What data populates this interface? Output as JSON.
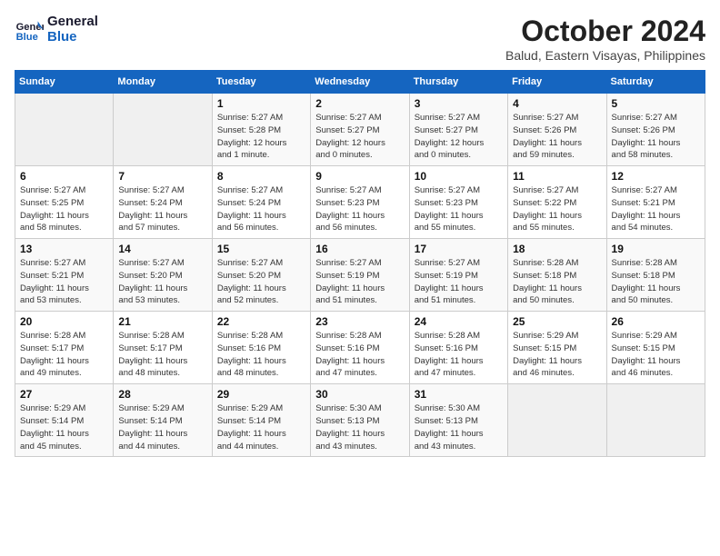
{
  "logo": {
    "line1": "General",
    "line2": "Blue"
  },
  "title": "October 2024",
  "subtitle": "Balud, Eastern Visayas, Philippines",
  "days_header": [
    "Sunday",
    "Monday",
    "Tuesday",
    "Wednesday",
    "Thursday",
    "Friday",
    "Saturday"
  ],
  "weeks": [
    [
      {
        "num": "",
        "info": ""
      },
      {
        "num": "",
        "info": ""
      },
      {
        "num": "1",
        "info": "Sunrise: 5:27 AM\nSunset: 5:28 PM\nDaylight: 12 hours\nand 1 minute."
      },
      {
        "num": "2",
        "info": "Sunrise: 5:27 AM\nSunset: 5:27 PM\nDaylight: 12 hours\nand 0 minutes."
      },
      {
        "num": "3",
        "info": "Sunrise: 5:27 AM\nSunset: 5:27 PM\nDaylight: 12 hours\nand 0 minutes."
      },
      {
        "num": "4",
        "info": "Sunrise: 5:27 AM\nSunset: 5:26 PM\nDaylight: 11 hours\nand 59 minutes."
      },
      {
        "num": "5",
        "info": "Sunrise: 5:27 AM\nSunset: 5:26 PM\nDaylight: 11 hours\nand 58 minutes."
      }
    ],
    [
      {
        "num": "6",
        "info": "Sunrise: 5:27 AM\nSunset: 5:25 PM\nDaylight: 11 hours\nand 58 minutes."
      },
      {
        "num": "7",
        "info": "Sunrise: 5:27 AM\nSunset: 5:24 PM\nDaylight: 11 hours\nand 57 minutes."
      },
      {
        "num": "8",
        "info": "Sunrise: 5:27 AM\nSunset: 5:24 PM\nDaylight: 11 hours\nand 56 minutes."
      },
      {
        "num": "9",
        "info": "Sunrise: 5:27 AM\nSunset: 5:23 PM\nDaylight: 11 hours\nand 56 minutes."
      },
      {
        "num": "10",
        "info": "Sunrise: 5:27 AM\nSunset: 5:23 PM\nDaylight: 11 hours\nand 55 minutes."
      },
      {
        "num": "11",
        "info": "Sunrise: 5:27 AM\nSunset: 5:22 PM\nDaylight: 11 hours\nand 55 minutes."
      },
      {
        "num": "12",
        "info": "Sunrise: 5:27 AM\nSunset: 5:21 PM\nDaylight: 11 hours\nand 54 minutes."
      }
    ],
    [
      {
        "num": "13",
        "info": "Sunrise: 5:27 AM\nSunset: 5:21 PM\nDaylight: 11 hours\nand 53 minutes."
      },
      {
        "num": "14",
        "info": "Sunrise: 5:27 AM\nSunset: 5:20 PM\nDaylight: 11 hours\nand 53 minutes."
      },
      {
        "num": "15",
        "info": "Sunrise: 5:27 AM\nSunset: 5:20 PM\nDaylight: 11 hours\nand 52 minutes."
      },
      {
        "num": "16",
        "info": "Sunrise: 5:27 AM\nSunset: 5:19 PM\nDaylight: 11 hours\nand 51 minutes."
      },
      {
        "num": "17",
        "info": "Sunrise: 5:27 AM\nSunset: 5:19 PM\nDaylight: 11 hours\nand 51 minutes."
      },
      {
        "num": "18",
        "info": "Sunrise: 5:28 AM\nSunset: 5:18 PM\nDaylight: 11 hours\nand 50 minutes."
      },
      {
        "num": "19",
        "info": "Sunrise: 5:28 AM\nSunset: 5:18 PM\nDaylight: 11 hours\nand 50 minutes."
      }
    ],
    [
      {
        "num": "20",
        "info": "Sunrise: 5:28 AM\nSunset: 5:17 PM\nDaylight: 11 hours\nand 49 minutes."
      },
      {
        "num": "21",
        "info": "Sunrise: 5:28 AM\nSunset: 5:17 PM\nDaylight: 11 hours\nand 48 minutes."
      },
      {
        "num": "22",
        "info": "Sunrise: 5:28 AM\nSunset: 5:16 PM\nDaylight: 11 hours\nand 48 minutes."
      },
      {
        "num": "23",
        "info": "Sunrise: 5:28 AM\nSunset: 5:16 PM\nDaylight: 11 hours\nand 47 minutes."
      },
      {
        "num": "24",
        "info": "Sunrise: 5:28 AM\nSunset: 5:16 PM\nDaylight: 11 hours\nand 47 minutes."
      },
      {
        "num": "25",
        "info": "Sunrise: 5:29 AM\nSunset: 5:15 PM\nDaylight: 11 hours\nand 46 minutes."
      },
      {
        "num": "26",
        "info": "Sunrise: 5:29 AM\nSunset: 5:15 PM\nDaylight: 11 hours\nand 46 minutes."
      }
    ],
    [
      {
        "num": "27",
        "info": "Sunrise: 5:29 AM\nSunset: 5:14 PM\nDaylight: 11 hours\nand 45 minutes."
      },
      {
        "num": "28",
        "info": "Sunrise: 5:29 AM\nSunset: 5:14 PM\nDaylight: 11 hours\nand 44 minutes."
      },
      {
        "num": "29",
        "info": "Sunrise: 5:29 AM\nSunset: 5:14 PM\nDaylight: 11 hours\nand 44 minutes."
      },
      {
        "num": "30",
        "info": "Sunrise: 5:30 AM\nSunset: 5:13 PM\nDaylight: 11 hours\nand 43 minutes."
      },
      {
        "num": "31",
        "info": "Sunrise: 5:30 AM\nSunset: 5:13 PM\nDaylight: 11 hours\nand 43 minutes."
      },
      {
        "num": "",
        "info": ""
      },
      {
        "num": "",
        "info": ""
      }
    ]
  ]
}
